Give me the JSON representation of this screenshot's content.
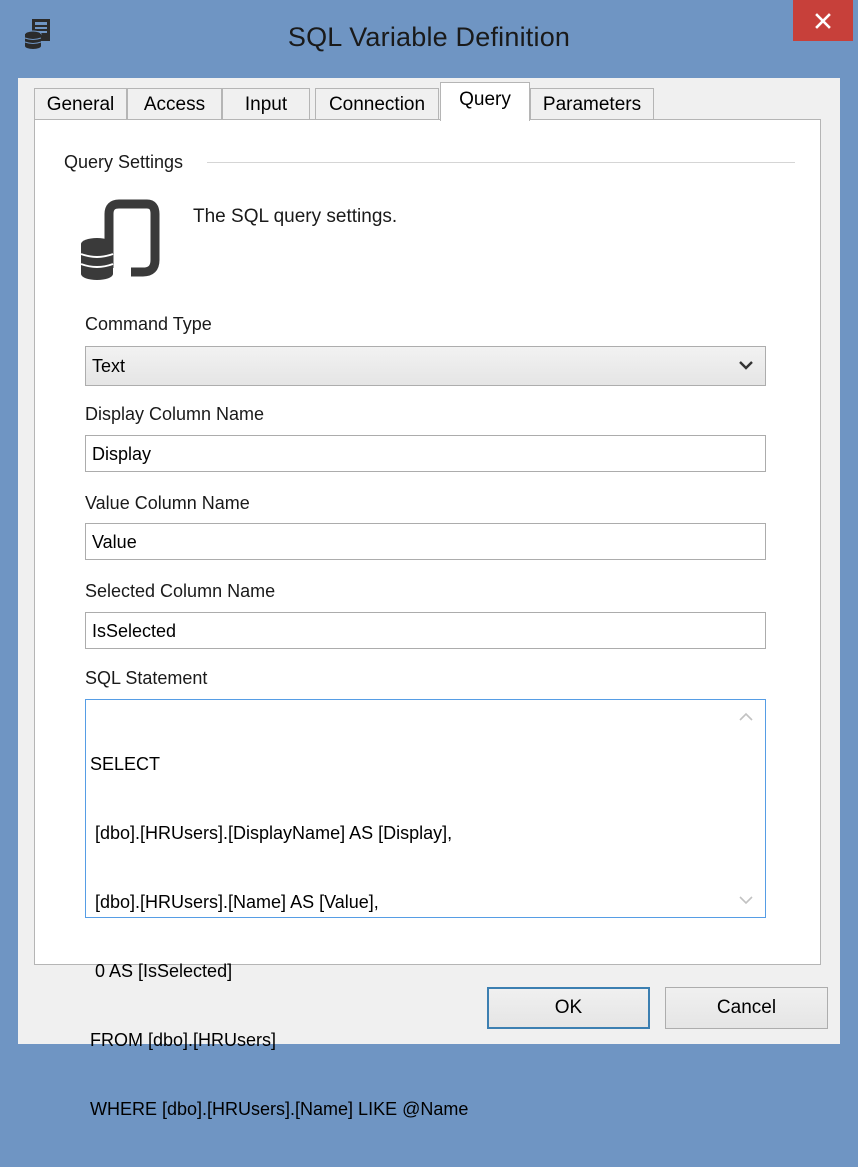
{
  "window": {
    "title": "SQL Variable Definition",
    "close_glyph": "✕",
    "app_icon": "database-window-icon"
  },
  "tabs": [
    {
      "label": "General",
      "active": false
    },
    {
      "label": "Access",
      "active": false
    },
    {
      "label": "Input",
      "active": false
    },
    {
      "label": "Connection",
      "active": false
    },
    {
      "label": "Query",
      "active": true
    },
    {
      "label": "Parameters",
      "active": false
    }
  ],
  "query_panel": {
    "group_label": "Query Settings",
    "description": "The SQL query settings.",
    "header_icon": "sql-query-icon",
    "command_type": {
      "label": "Command Type",
      "value": "Text"
    },
    "display_column": {
      "label": "Display Column Name",
      "value": "Display"
    },
    "value_column": {
      "label": "Value Column Name",
      "value": "Value"
    },
    "selected_column": {
      "label": "Selected Column Name",
      "value": "IsSelected"
    },
    "sql_statement": {
      "label": "SQL Statement",
      "lines": [
        "SELECT",
        " [dbo].[HRUsers].[DisplayName] AS [Display],",
        " [dbo].[HRUsers].[Name] AS [Value],",
        " 0 AS [IsSelected]",
        "FROM [dbo].[HRUsers]",
        "WHERE [dbo].[HRUsers].[Name] LIKE @Name"
      ]
    }
  },
  "buttons": {
    "ok": "OK",
    "cancel": "Cancel"
  },
  "colors": {
    "frame": "#6f95c3",
    "close": "#c7403a",
    "focus_border": "#569de5",
    "default_button_border": "#3c7fb1"
  }
}
